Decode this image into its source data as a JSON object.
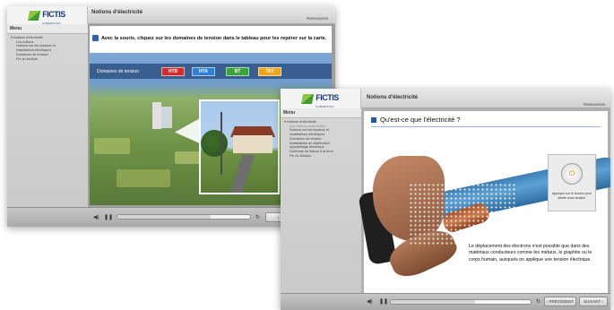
{
  "screen1": {
    "logo_text": "FICTIS",
    "logo_sub": "FORMATION",
    "title": "Notions d'électricité",
    "resources": "Ressources",
    "menu_label": "Menu",
    "menu": [
      {
        "label": "▾ Notions d'électricité"
      },
      {
        "label": "Les notions"
      },
      {
        "label": "Notions sur les réseaux et"
      },
      {
        "label": "installations électriques"
      },
      {
        "label": "Domaines de tension"
      },
      {
        "label": "Fin du Module"
      }
    ],
    "instruction": "Avec la souris, cliquez sur les domaines de tension dans le tableau pour les repérer sur la carte.",
    "domain_label": "Domaines de tension",
    "tags": [
      {
        "label": "HTB",
        "color": "#d72b2b"
      },
      {
        "label": "HTA",
        "color": "#2f7fd6"
      },
      {
        "label": "BT",
        "color": "#3aa33a"
      },
      {
        "label": "TBT",
        "color": "#f0a419"
      }
    ],
    "prev_label": "‹ PRÉ"
  },
  "screen2": {
    "logo_text": "FICTIS",
    "logo_sub": "FORMATION",
    "title": "Notions d'électricité",
    "resources": "Ressources",
    "menu_label": "Menu",
    "menu": [
      {
        "label": "▾ Notions d'électricité",
        "dim": false
      },
      {
        "label": "Les notions essentielles",
        "dim": true
      },
      {
        "label": "Notions sur les réseaux et",
        "dim": false
      },
      {
        "label": "installations électriques",
        "dim": false
      },
      {
        "label": "Domaines de tension",
        "dim": false
      },
      {
        "label": "Installations de distribution",
        "dim": false
      },
      {
        "label": "Appareillage électrique",
        "dim": false
      },
      {
        "label": "Schémas de liaison à la terre",
        "dim": false
      },
      {
        "label": "Fin du Module",
        "dim": false
      }
    ],
    "question": "Qu'est-ce que l'électricité ?",
    "tip": "Appuyez sur le bouton pour mettre sous tension.",
    "body": "Le déplacement des électrons n'est possible que dans des matériaux conducteurs comme les métaux, le graphite ou le corps humain, auxquels on applique une tension électrique.",
    "prev_label": "‹ PRÉCÉDENT",
    "next_label": "SUIVANT ›"
  },
  "icons": {
    "volume": "◀)",
    "pause": "❚❚",
    "refresh": "↻",
    "power": "⏻"
  }
}
